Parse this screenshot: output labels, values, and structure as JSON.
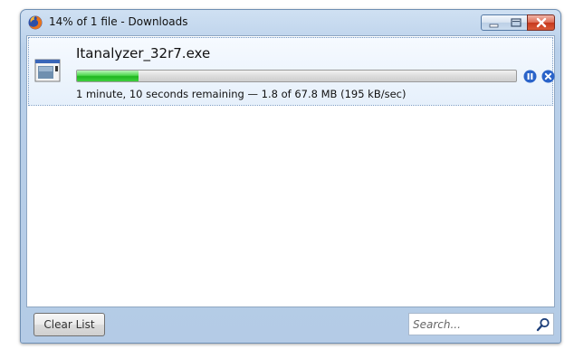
{
  "window": {
    "title": "14% of 1 file - Downloads"
  },
  "download": {
    "file_name": "Itanalyzer_32r7.exe",
    "progress_fraction": 0.14,
    "status": "1 minute, 10 seconds remaining — 1.8 of 67.8 MB (195 kB/sec)"
  },
  "footer": {
    "clear_list_label": "Clear List",
    "search_placeholder": "Search..."
  },
  "icons": {
    "app": "firefox-icon",
    "file": "executable-file-icon",
    "pause": "pause-icon",
    "cancel": "cancel-icon",
    "search": "magnifier-icon",
    "minimize": "minimize-icon",
    "maximize": "maximize-icon",
    "close": "close-icon"
  },
  "colors": {
    "progress_green": "#2fc42f",
    "action_blue": "#2a63c9",
    "close_red": "#c7391d"
  }
}
